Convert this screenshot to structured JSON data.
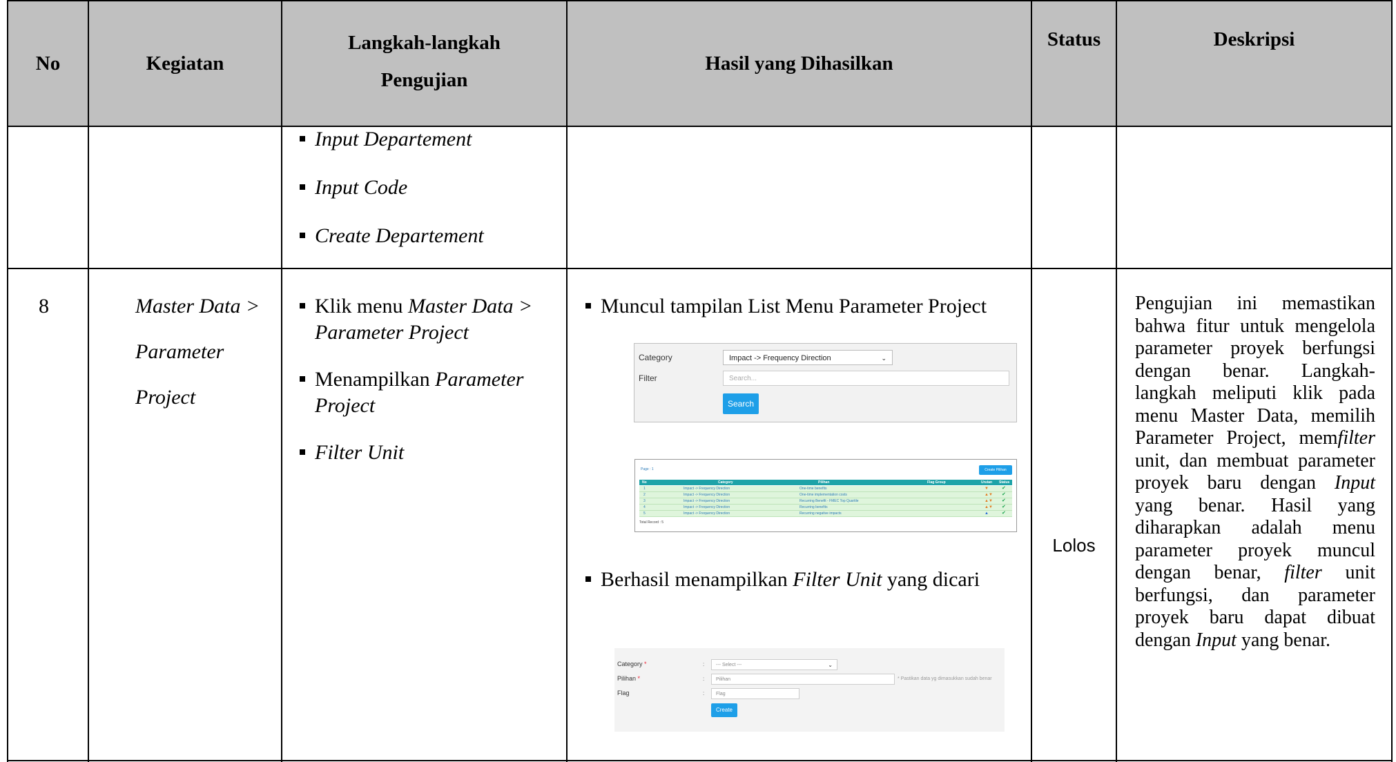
{
  "table": {
    "headers": {
      "no": "No",
      "kegiatan": "Kegiatan",
      "langkah_1": "Langkah-langkah",
      "langkah_2": "Pengujian",
      "hasil": "Hasil yang Dihasilkan",
      "status": "Status",
      "deskripsi": "Deskripsi"
    },
    "prev_row": {
      "steps": [
        "Input Departement",
        "Input Code",
        "Create Departement"
      ]
    },
    "row8": {
      "no": "8",
      "kegiatan_1": "Master Data >",
      "kegiatan_2": "Parameter",
      "kegiatan_3": "Project",
      "step1_a": "Klik menu ",
      "step1_b": "Master Data >",
      "step1_c": "Parameter Project",
      "step2_a": "Menampilkan ",
      "step2_b": "Parameter",
      "step2_c": "Project",
      "step3": "Filter Unit",
      "hasil1": "Muncul tampilan List Menu Parameter Project",
      "hasil2_a": "Berhasil menampilkan ",
      "hasil2_b": "Filter Unit",
      "hasil2_c": " yang dicari",
      "status": "Lolos",
      "deskripsi_lines": [
        {
          "parts": [
            [
              "Pengujian ini memastikan",
              false
            ]
          ]
        },
        {
          "parts": [
            [
              "bahwa fitur untuk mengelola",
              false
            ]
          ]
        },
        {
          "parts": [
            [
              "parameter proyek berfungsi",
              false
            ]
          ]
        },
        {
          "parts": [
            [
              "dengan benar. Langkah-",
              false
            ]
          ]
        },
        {
          "parts": [
            [
              "langkah meliputi klik pada",
              false
            ]
          ]
        },
        {
          "parts": [
            [
              "menu Master Data, memilih",
              false
            ]
          ]
        },
        {
          "parts": [
            [
              "Parameter Project, mem",
              false
            ],
            [
              "filter",
              true
            ]
          ]
        },
        {
          "parts": [
            [
              "unit, dan membuat parameter",
              false
            ]
          ]
        },
        {
          "parts": [
            [
              "proyek baru dengan ",
              false
            ],
            [
              "Input",
              true
            ]
          ]
        },
        {
          "parts": [
            [
              "yang benar. Hasil yang",
              false
            ]
          ]
        },
        {
          "parts": [
            [
              "diharapkan adalah menu",
              false
            ]
          ]
        },
        {
          "parts": [
            [
              "parameter proyek muncul",
              false
            ]
          ]
        },
        {
          "parts": [
            [
              "dengan benar, ",
              false
            ],
            [
              "filter",
              true
            ],
            [
              " unit",
              false
            ]
          ]
        },
        {
          "parts": [
            [
              "berfungsi, dan parameter",
              false
            ]
          ]
        },
        {
          "parts": [
            [
              "proyek baru dapat dibuat",
              false
            ]
          ]
        },
        {
          "parts": [
            [
              "dengan ",
              false
            ],
            [
              "Input",
              true
            ],
            [
              " yang benar.",
              false
            ]
          ]
        }
      ]
    }
  },
  "screenshot1": {
    "category_label": "Category",
    "category_value": "Impact -> Frequency Direction",
    "filter_label": "Filter",
    "filter_placeholder": "Search...",
    "search_button": "Search"
  },
  "screenshot2": {
    "page_label": "Page : 1",
    "create_button": "Create Pilihan",
    "columns": [
      "No",
      "Category",
      "Pilihan",
      "Flag Group",
      "Urutan",
      "Status"
    ],
    "rows": [
      {
        "no": "1",
        "category": "Impact -> Frequency Direction",
        "pilihan": "One-time benefits"
      },
      {
        "no": "2",
        "category": "Impact -> Frequency Direction",
        "pilihan": "One-time implementation costs"
      },
      {
        "no": "3",
        "category": "Impact -> Frequency Direction",
        "pilihan": "Recurring Benefit - FMEC Top Quartile"
      },
      {
        "no": "4",
        "category": "Impact -> Frequency Direction",
        "pilihan": "Recurring benefits"
      },
      {
        "no": "5",
        "category": "Impact -> Frequency Direction",
        "pilihan": "Recurring negative impacts"
      }
    ],
    "total": "Total Record : 5"
  },
  "screenshot3": {
    "category_label": "Category",
    "category_value": "--- Select ---",
    "pilihan_label": "Pilihan",
    "pilihan_placeholder": "Pilihan",
    "pilihan_hint": "* Pastikan data yg dimasukkan sudah benar",
    "flag_label": "Flag",
    "flag_placeholder": "Flag",
    "create_button": "Create",
    "required_mark": "*",
    "colon": ":"
  }
}
